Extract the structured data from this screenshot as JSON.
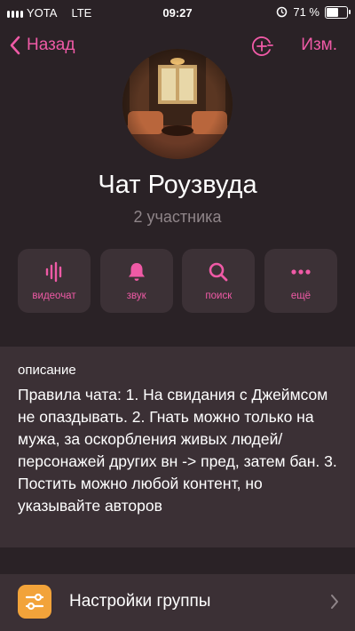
{
  "status_bar": {
    "carrier": "YOTA",
    "network": "LTE",
    "time": "09:27",
    "battery": "71 %",
    "battery_level": 0.71
  },
  "nav": {
    "back_label": "Назад",
    "edit_label": "Изм."
  },
  "chat": {
    "title": "Чат Роузвуда",
    "subtitle": "2 участника"
  },
  "actions": [
    {
      "label": "видеочат",
      "icon": "voice-wave-icon"
    },
    {
      "label": "звук",
      "icon": "bell-icon"
    },
    {
      "label": "поиск",
      "icon": "search-icon"
    },
    {
      "label": "ещё",
      "icon": "more-dots-icon"
    }
  ],
  "description": {
    "label": "описание",
    "text": "Правила чата: 1. На свидания с Джеймсом не опаздывать. 2. Гнать можно только на мужа, за оскорбления живых людей/ персонажей других вн -> пред, затем бан. 3. Постить можно любой контент, но указывайте авторов"
  },
  "settings": {
    "label": "Настройки группы",
    "icon": "sliders-icon"
  },
  "colors": {
    "accent": "#ef5aa6",
    "background": "#2a2226",
    "card": "#3b3035",
    "settings_icon_bg": "#f2a33a"
  }
}
